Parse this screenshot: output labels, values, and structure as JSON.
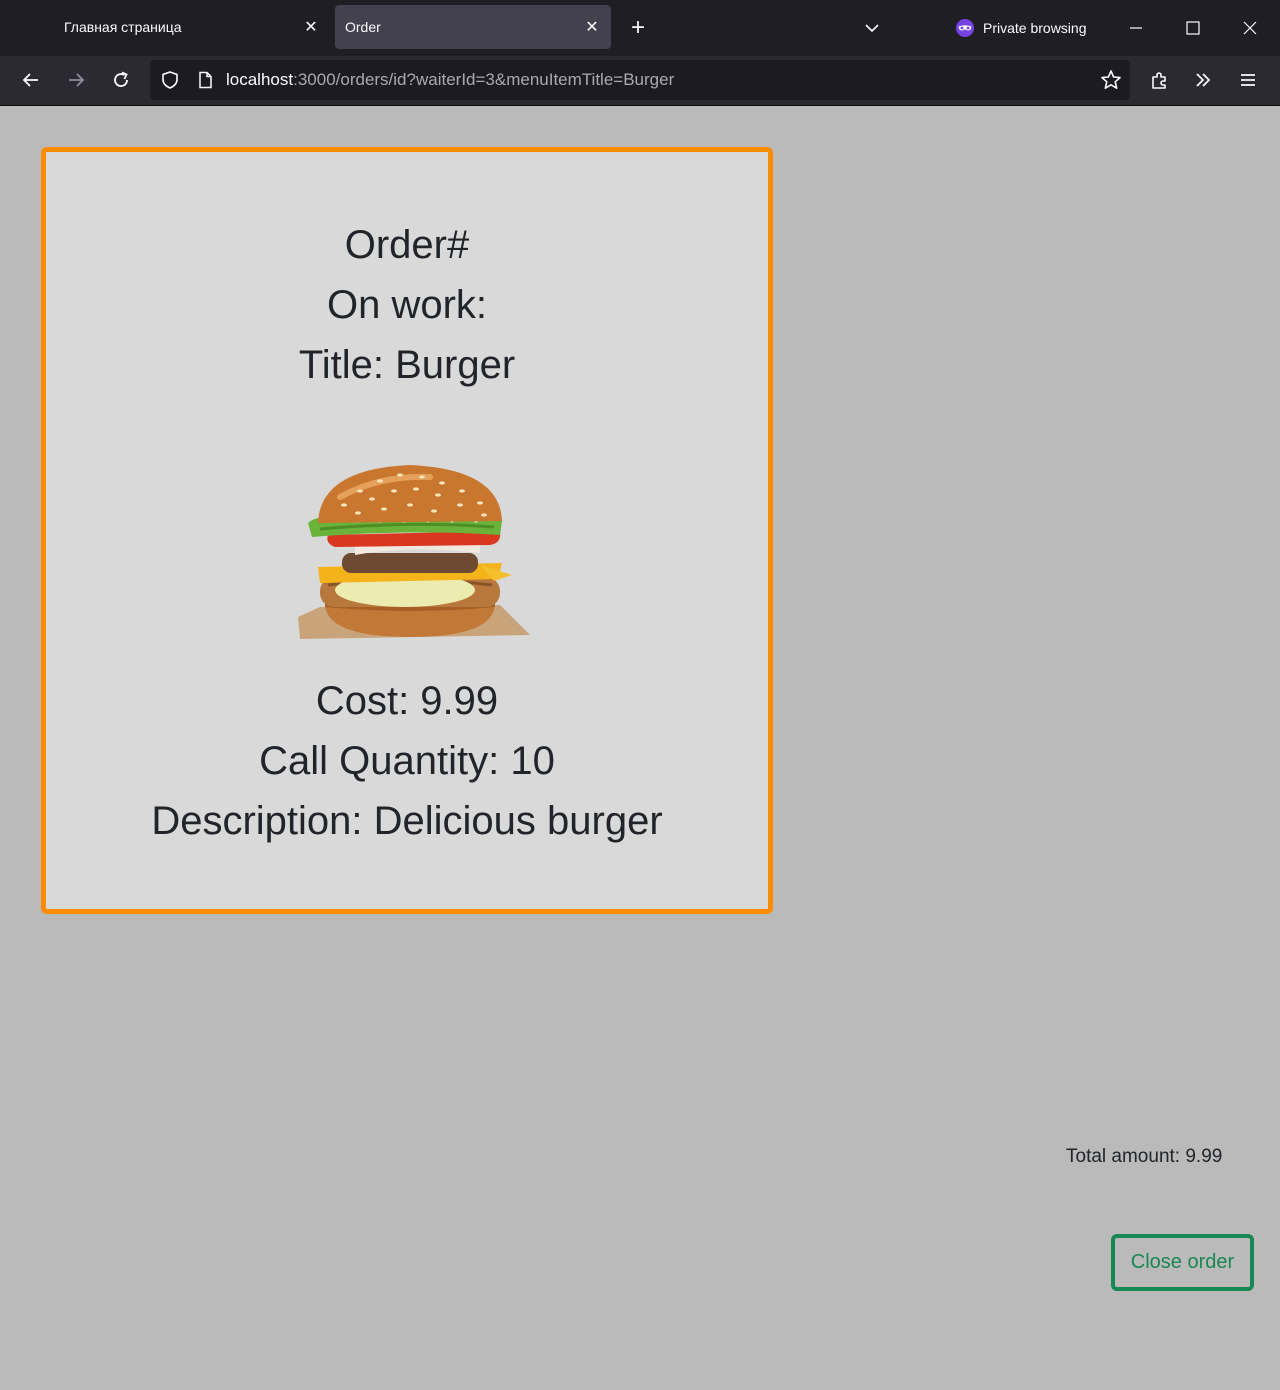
{
  "browser": {
    "tabs": [
      {
        "label": "Главная страница",
        "active": false
      },
      {
        "label": "Order",
        "active": true
      }
    ],
    "private_label": "Private browsing",
    "url_host": "localhost",
    "url_rest": ":3000/orders/id?waiterId=3&menuItemTitle=Burger"
  },
  "order": {
    "order_label": "Order#",
    "on_work_label": "On work:",
    "title_line": "Title: Burger",
    "cost_line": "Cost: 9.99",
    "quantity_line": "Call Quantity: 10",
    "description_line": "Description: Delicious burger",
    "image_icon": "burger-image"
  },
  "footer": {
    "total_line": "Total amount: 9.99",
    "close_button_label": "Close order"
  },
  "colors": {
    "card_border": "#fb8c00",
    "card_bg": "#d9d9d9",
    "page_bg": "#bababa",
    "button_green": "#198754"
  }
}
